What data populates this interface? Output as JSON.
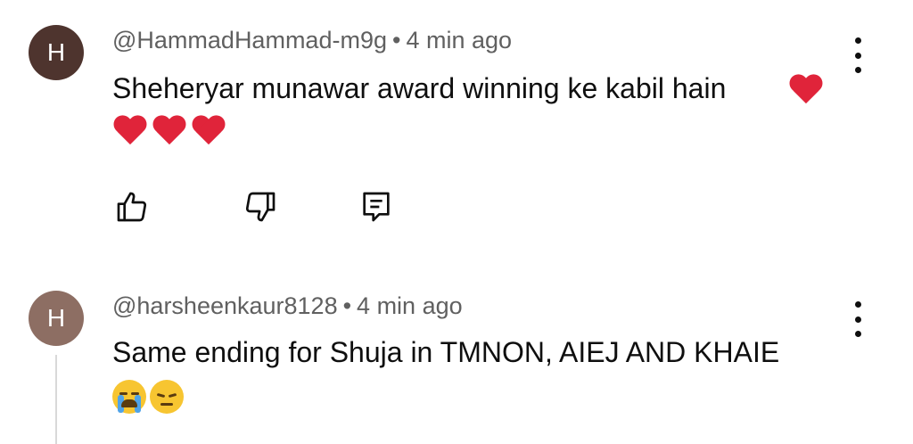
{
  "comments": [
    {
      "avatar_letter": "H",
      "handle": "@HammadHammad-m9g",
      "separator": "•",
      "time": "4 min ago",
      "text": "Sheheryar munawar award winning ke kabil hain",
      "emojis": [
        "red-heart",
        "red-heart",
        "red-heart",
        "red-heart"
      ],
      "avatar_color": "#4e342e"
    },
    {
      "avatar_letter": "H",
      "handle": "@harsheenkaur8128",
      "separator": "•",
      "time": "4 min ago",
      "text": "Same ending for Shuja in TMNON,  AIEJ AND KHAIE",
      "emojis": [
        "loudly-crying-face",
        "pensive-face"
      ],
      "avatar_color": "#8d6e63"
    }
  ],
  "icons": {
    "like": "thumbs-up-icon",
    "dislike": "thumbs-down-icon",
    "reply": "reply-icon",
    "menu": "more-vertical-icon"
  },
  "colors": {
    "meta_text": "#606060",
    "body_text": "#0f0f0f",
    "heart": "#e0243a"
  }
}
